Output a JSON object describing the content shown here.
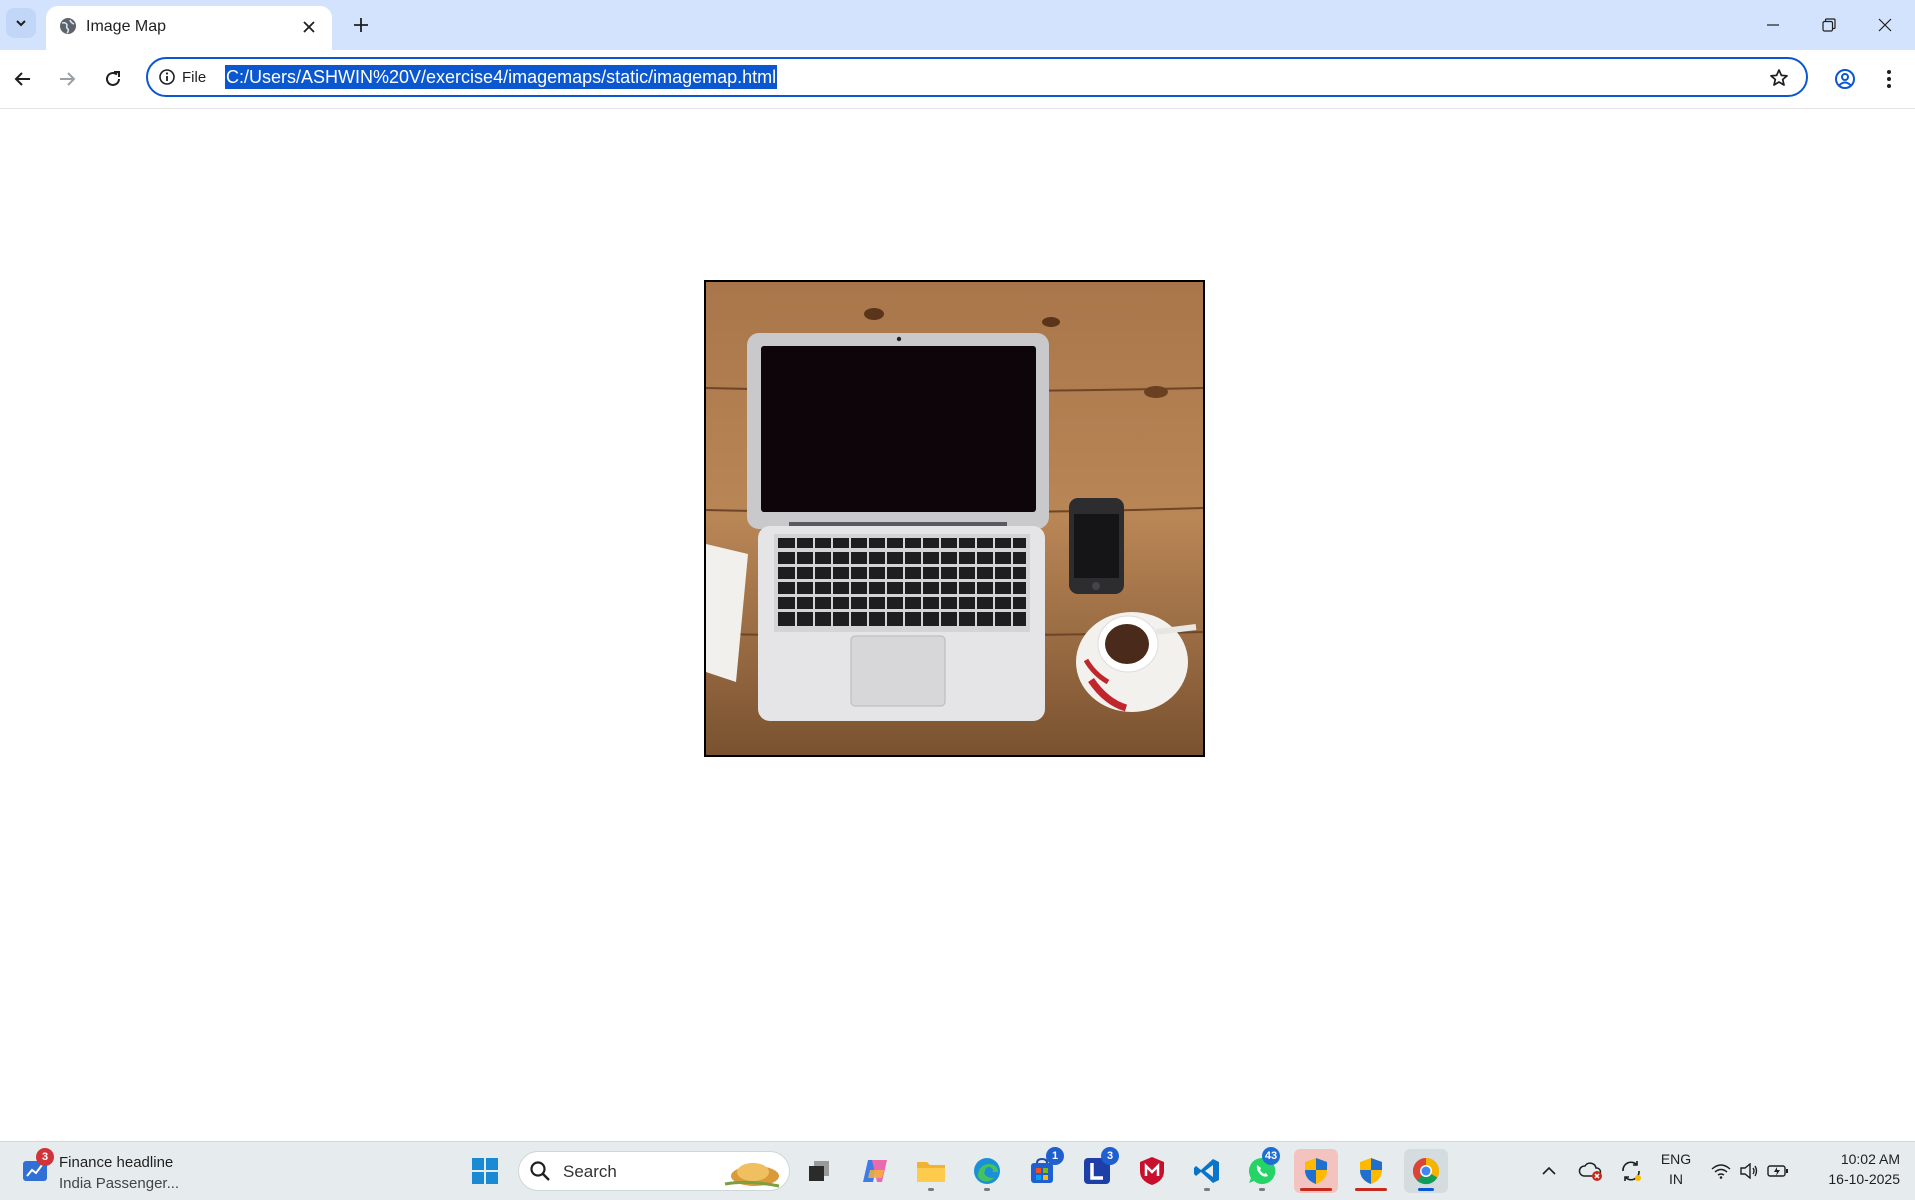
{
  "browser": {
    "tab": {
      "title": "Image Map"
    },
    "address_bar": {
      "scheme_label": "File",
      "url": "C:/Users/ASHWIN%20V/exercise4/imagemaps/static/imagemap.html"
    }
  },
  "page": {
    "image": {
      "description_icon": "laptop-desk-photo"
    }
  },
  "taskbar": {
    "widget": {
      "badge": "3",
      "headline": "Finance headline",
      "subtext": "India Passenger..."
    },
    "search": {
      "placeholder": "Search"
    },
    "badges": {
      "store": "1",
      "lens": "3",
      "whatsapp": "43"
    },
    "language": {
      "line1": "ENG",
      "line2": "IN"
    },
    "clock": {
      "time": "10:02 AM",
      "date": "16-10-2025"
    }
  },
  "colors": {
    "tabstrip": "#d3e3fd",
    "accent": "#0b57d0",
    "taskbar": "#e6ecee"
  }
}
